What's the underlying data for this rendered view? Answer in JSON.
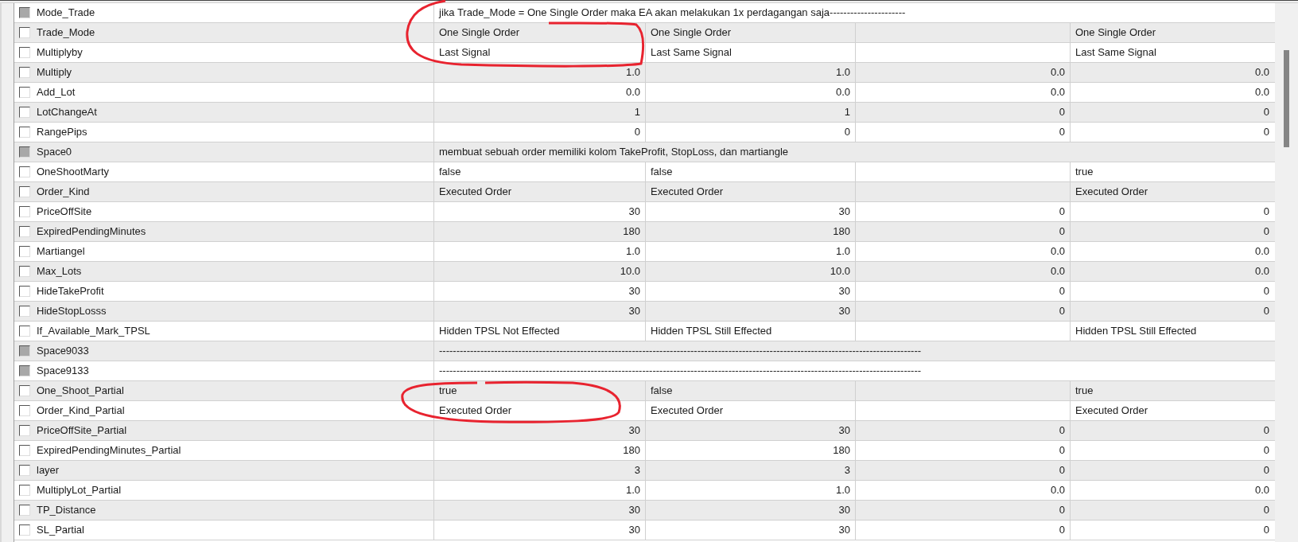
{
  "rows": [
    {
      "name": "Mode_Trade",
      "kind": "comment",
      "checked": false,
      "disabled": true,
      "text": "jika Trade_Mode = One Single Order maka EA akan melakukan 1x perdagangan saja----------------------"
    },
    {
      "name": "Trade_Mode",
      "kind": "text",
      "checked": false,
      "disabled": false,
      "values": {
        "col_1": "One Single Order",
        "col_2": "One Single Order",
        "col_4": "One Single Order"
      }
    },
    {
      "name": "Multiplyby",
      "kind": "text",
      "checked": false,
      "disabled": false,
      "values": {
        "col_1": "Last Signal",
        "col_2": "Last Same Signal",
        "col_4": "Last Same Signal"
      }
    },
    {
      "name": "Multiply",
      "kind": "number",
      "checked": false,
      "disabled": false,
      "values": {
        "col_1": "1.0",
        "col_2": "1.0",
        "col_3": "0.0",
        "col_4": "0.0"
      }
    },
    {
      "name": "Add_Lot",
      "kind": "number",
      "checked": false,
      "disabled": false,
      "values": {
        "col_1": "0.0",
        "col_2": "0.0",
        "col_3": "0.0",
        "col_4": "0.0"
      }
    },
    {
      "name": "LotChangeAt",
      "kind": "number",
      "checked": false,
      "disabled": false,
      "values": {
        "col_1": "1",
        "col_2": "1",
        "col_3": "0",
        "col_4": "0"
      }
    },
    {
      "name": "RangePips",
      "kind": "number",
      "checked": false,
      "disabled": false,
      "values": {
        "col_1": "0",
        "col_2": "0",
        "col_3": "0",
        "col_4": "0"
      }
    },
    {
      "name": "Space0",
      "kind": "comment",
      "checked": false,
      "disabled": true,
      "text": "membuat sebuah order memiliki kolom TakeProfit, StopLoss, dan martiangle"
    },
    {
      "name": "OneShootMarty",
      "kind": "text",
      "checked": false,
      "disabled": false,
      "values": {
        "col_1": "false",
        "col_2": "false",
        "col_4": "true"
      }
    },
    {
      "name": "Order_Kind",
      "kind": "text",
      "checked": false,
      "disabled": false,
      "values": {
        "col_1": "Executed Order",
        "col_2": "Executed Order",
        "col_4": "Executed Order"
      }
    },
    {
      "name": "PriceOffSite",
      "kind": "number",
      "checked": false,
      "disabled": false,
      "values": {
        "col_1": "30",
        "col_2": "30",
        "col_3": "0",
        "col_4": "0"
      }
    },
    {
      "name": "ExpiredPendingMinutes",
      "kind": "number",
      "checked": false,
      "disabled": false,
      "values": {
        "col_1": "180",
        "col_2": "180",
        "col_3": "0",
        "col_4": "0"
      }
    },
    {
      "name": "Martiangel",
      "kind": "number",
      "checked": false,
      "disabled": false,
      "values": {
        "col_1": "1.0",
        "col_2": "1.0",
        "col_3": "0.0",
        "col_4": "0.0"
      }
    },
    {
      "name": "Max_Lots",
      "kind": "number",
      "checked": false,
      "disabled": false,
      "values": {
        "col_1": "10.0",
        "col_2": "10.0",
        "col_3": "0.0",
        "col_4": "0.0"
      }
    },
    {
      "name": "HideTakeProfit",
      "kind": "number",
      "checked": false,
      "disabled": false,
      "values": {
        "col_1": "30",
        "col_2": "30",
        "col_3": "0",
        "col_4": "0"
      }
    },
    {
      "name": "HideStopLosss",
      "kind": "number",
      "checked": false,
      "disabled": false,
      "values": {
        "col_1": "30",
        "col_2": "30",
        "col_3": "0",
        "col_4": "0"
      }
    },
    {
      "name": "If_Available_Mark_TPSL",
      "kind": "text",
      "checked": false,
      "disabled": false,
      "values": {
        "col_1": "Hidden TPSL Not Effected",
        "col_2": "Hidden TPSL Still Effected",
        "col_4": "Hidden TPSL Still Effected"
      }
    },
    {
      "name": "Space9033",
      "kind": "comment",
      "checked": false,
      "disabled": true,
      "text": "--------------------------------------------------------------------------------------------------------------------------------------------"
    },
    {
      "name": "Space9133",
      "kind": "comment",
      "checked": false,
      "disabled": true,
      "text": "--------------------------------------------------------------------------------------------------------------------------------------------"
    },
    {
      "name": "One_Shoot_Partial",
      "kind": "text",
      "checked": false,
      "disabled": false,
      "values": {
        "col_1": "true",
        "col_2": "false",
        "col_4": "true"
      }
    },
    {
      "name": "Order_Kind_Partial",
      "kind": "text",
      "checked": false,
      "disabled": false,
      "values": {
        "col_1": "Executed Order",
        "col_2": "Executed Order",
        "col_4": "Executed Order"
      }
    },
    {
      "name": "PriceOffSite_Partial",
      "kind": "number",
      "checked": false,
      "disabled": false,
      "values": {
        "col_1": "30",
        "col_2": "30",
        "col_3": "0",
        "col_4": "0"
      }
    },
    {
      "name": "ExpiredPendingMinutes_Partial",
      "kind": "number",
      "checked": false,
      "disabled": false,
      "values": {
        "col_1": "180",
        "col_2": "180",
        "col_3": "0",
        "col_4": "0"
      }
    },
    {
      "name": "layer",
      "kind": "number",
      "checked": false,
      "disabled": false,
      "values": {
        "col_1": "3",
        "col_2": "3",
        "col_3": "0",
        "col_4": "0"
      }
    },
    {
      "name": "MultiplyLot_Partial",
      "kind": "number",
      "checked": false,
      "disabled": false,
      "values": {
        "col_1": "1.0",
        "col_2": "1.0",
        "col_3": "0.0",
        "col_4": "0.0"
      }
    },
    {
      "name": "TP_Distance",
      "kind": "number",
      "checked": false,
      "disabled": false,
      "values": {
        "col_1": "30",
        "col_2": "30",
        "col_3": "0",
        "col_4": "0"
      }
    },
    {
      "name": "SL_Partial",
      "kind": "number",
      "checked": false,
      "disabled": false,
      "values": {
        "col_1": "30",
        "col_2": "30",
        "col_3": "0",
        "col_4": "0"
      }
    }
  ]
}
